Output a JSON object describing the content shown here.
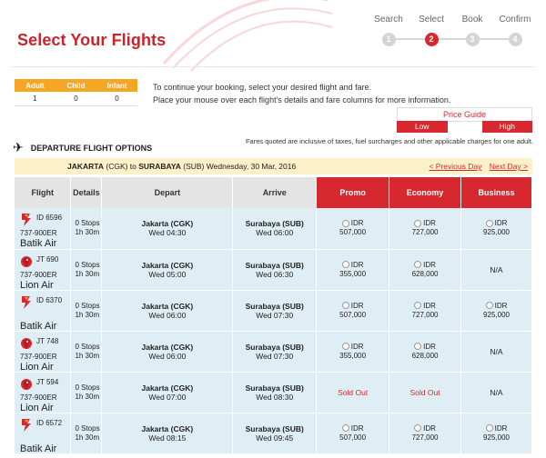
{
  "header": {
    "title": "Select Your Flights",
    "steps": [
      {
        "label": "Search",
        "num": "1",
        "active": false
      },
      {
        "label": "Select",
        "num": "2",
        "active": true
      },
      {
        "label": "Book",
        "num": "3",
        "active": false
      },
      {
        "label": "Confirm",
        "num": "4",
        "active": false
      }
    ]
  },
  "passengers": {
    "headers": [
      "Adult",
      "Child",
      "Infant"
    ],
    "values": [
      "1",
      "0",
      "0"
    ]
  },
  "info": {
    "line1": "To continue your booking, select your desired flight and fare.",
    "line2": "Place your mouse over each flight's details and fare columns for more information."
  },
  "price_guide": {
    "title": "Price Guide",
    "low": "Low",
    "high": "High"
  },
  "fare_note": "Fares quoted are inclusive of taxes, fuel surcharges and other applicable charges for one adult.",
  "departure": {
    "title": "DEPARTURE FLIGHT OPTIONS",
    "route": {
      "from": "JAKARTA",
      "from_code": "(CGK) to",
      "to": "SURABAYA",
      "to_code": "(SUB)",
      "date": "Wednesday, 30 Mar, 2016"
    },
    "prev_day": "< Previous Day",
    "next_day": "Next Day >"
  },
  "table": {
    "headers": {
      "flight": "Flight",
      "details": "Details",
      "depart": "Depart",
      "arrive": "Arrive",
      "promo": "Promo",
      "economy": "Economy",
      "business": "Business"
    },
    "rows": [
      {
        "airline": "Batik Air",
        "logo": "batik",
        "flight_no": "ID 6596",
        "aircraft": "737-900ER",
        "stops": "0 Stops",
        "duration": "1h 30m",
        "dep_loc": "Jakarta (CGK)",
        "dep_time": "Wed 04:30",
        "arr_loc": "Surabaya (SUB)",
        "arr_time": "Wed 06:00",
        "promo": {
          "cur": "IDR",
          "amt": "507,000"
        },
        "economy": {
          "cur": "IDR",
          "amt": "727,000"
        },
        "business": {
          "cur": "IDR",
          "amt": "925,000"
        }
      },
      {
        "airline": "Lion Air",
        "logo": "lion",
        "flight_no": "JT 690",
        "aircraft": "737-900ER",
        "stops": "0 Stops",
        "duration": "1h 30m",
        "dep_loc": "Jakarta (CGK)",
        "dep_time": "Wed 05:00",
        "arr_loc": "Surabaya (SUB)",
        "arr_time": "Wed 06:30",
        "promo": {
          "cur": "IDR",
          "amt": "355,000"
        },
        "economy": {
          "cur": "IDR",
          "amt": "628,000"
        },
        "business": {
          "na": "N/A"
        }
      },
      {
        "airline": "Batik Air",
        "logo": "batik",
        "flight_no": "ID 6370",
        "aircraft": "",
        "stops": "0 Stops",
        "duration": "1h 30m",
        "dep_loc": "Jakarta (CGK)",
        "dep_time": "Wed 06:00",
        "arr_loc": "Surabaya (SUB)",
        "arr_time": "Wed 07:30",
        "promo": {
          "cur": "IDR",
          "amt": "507,000"
        },
        "economy": {
          "cur": "IDR",
          "amt": "727,000"
        },
        "business": {
          "cur": "IDR",
          "amt": "925,000"
        }
      },
      {
        "airline": "Lion Air",
        "logo": "lion",
        "flight_no": "JT 748",
        "aircraft": "737-900ER",
        "stops": "0 Stops",
        "duration": "1h 30m",
        "dep_loc": "Jakarta (CGK)",
        "dep_time": "Wed 06:00",
        "arr_loc": "Surabaya (SUB)",
        "arr_time": "Wed 07:30",
        "promo": {
          "cur": "IDR",
          "amt": "355,000"
        },
        "economy": {
          "cur": "IDR",
          "amt": "628,000"
        },
        "business": {
          "na": "N/A"
        }
      },
      {
        "airline": "Lion Air",
        "logo": "lion",
        "flight_no": "JT 594",
        "aircraft": "737-900ER",
        "stops": "0 Stops",
        "duration": "1h 30m",
        "dep_loc": "Jakarta (CGK)",
        "dep_time": "Wed 07:00",
        "arr_loc": "Surabaya (SUB)",
        "arr_time": "Wed 08:30",
        "promo": {
          "soldout": "Sold Out"
        },
        "economy": {
          "soldout": "Sold Out"
        },
        "business": {
          "na": "N/A"
        }
      },
      {
        "airline": "Batik Air",
        "logo": "batik",
        "flight_no": "ID 6572",
        "aircraft": "",
        "stops": "0 Stops",
        "duration": "1h 30m",
        "dep_loc": "Jakarta (CGK)",
        "dep_time": "Wed 08:15",
        "arr_loc": "Surabaya (SUB)",
        "arr_time": "Wed 09:45",
        "promo": {
          "cur": "IDR",
          "amt": "507,000"
        },
        "economy": {
          "cur": "IDR",
          "amt": "727,000"
        },
        "business": {
          "cur": "IDR",
          "amt": "925,000"
        }
      }
    ]
  },
  "colors": {
    "brand_red": "#d7282f",
    "title_red": "#cc2228",
    "pax_orange": "#f5a623",
    "row_blue": "#dfeef4",
    "route_yellow": "#fdf1c9"
  }
}
